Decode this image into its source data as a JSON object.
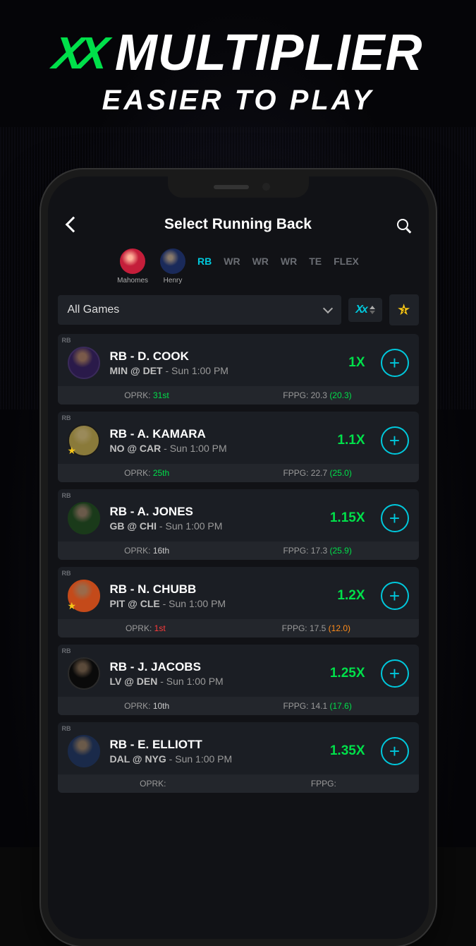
{
  "promo": {
    "title": "MULTIPLIER",
    "sub": "EASIER TO PLAY"
  },
  "nav": {
    "title": "Select Running Back"
  },
  "lineup": {
    "picks": [
      {
        "name": "Mahomes"
      },
      {
        "name": "Henry"
      }
    ],
    "slots": [
      "RB",
      "WR",
      "WR",
      "WR",
      "TE",
      "FLEX"
    ],
    "activeIndex": 0
  },
  "filters": {
    "dropdown": "All Games",
    "star_count": "3"
  },
  "positionTag": "RB",
  "players": [
    {
      "name": "RB - D. COOK",
      "game": "MIN @ DET",
      "time": " - Sun 1:00 PM",
      "mult": "1X",
      "oprk": "31st",
      "oprkClass": "green",
      "fppg": "20.3",
      "adj": "(20.3)",
      "adjClass": "",
      "av": "av1",
      "fav": false
    },
    {
      "name": "RB - A. KAMARA",
      "game": "NO @ CAR",
      "time": " - Sun 1:00 PM",
      "mult": "1.1X",
      "oprk": "25th",
      "oprkClass": "green",
      "fppg": "22.7",
      "adj": "(25.0)",
      "adjClass": "",
      "av": "av2",
      "fav": true
    },
    {
      "name": "RB - A. JONES",
      "game": "GB @ CHI",
      "time": " - Sun 1:00 PM",
      "mult": "1.15X",
      "oprk": "16th",
      "oprkClass": "gray",
      "fppg": "17.3",
      "adj": "(25.9)",
      "adjClass": "",
      "av": "av3",
      "fav": false
    },
    {
      "name": "RB - N. CHUBB",
      "game": "PIT @ CLE",
      "time": " - Sun 1:00 PM",
      "mult": "1.2X",
      "oprk": "1st",
      "oprkClass": "red",
      "fppg": "17.5",
      "adj": "(12.0)",
      "adjClass": "orange",
      "av": "av4",
      "fav": true
    },
    {
      "name": "RB - J. JACOBS",
      "game": "LV @ DEN",
      "time": " - Sun 1:00 PM",
      "mult": "1.25X",
      "oprk": "10th",
      "oprkClass": "gray",
      "fppg": "14.1",
      "adj": "(17.6)",
      "adjClass": "",
      "av": "av5",
      "fav": false
    },
    {
      "name": "RB - E. ELLIOTT",
      "game": "DAL @ NYG",
      "time": " - Sun 1:00 PM",
      "mult": "1.35X",
      "oprk": "",
      "oprkClass": "gray",
      "fppg": "",
      "adj": "",
      "adjClass": "",
      "av": "av6",
      "fav": false
    }
  ],
  "labels": {
    "oprk": "OPRK:",
    "fppg": "FPPG:"
  }
}
